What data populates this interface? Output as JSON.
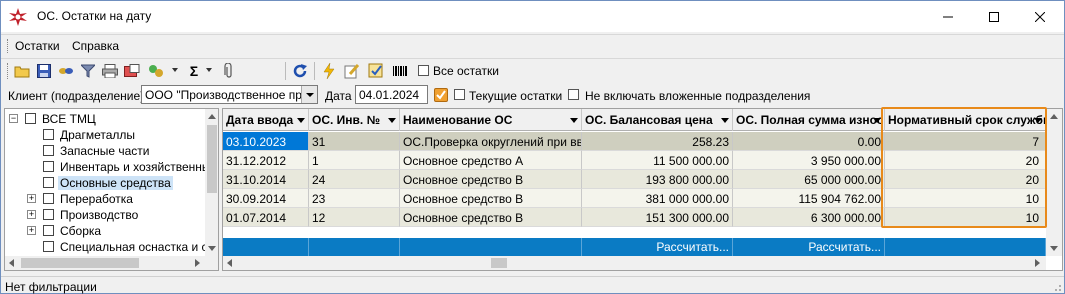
{
  "window": {
    "title": "ОС. Остатки на дату",
    "controls": {
      "minimize": "minimize-icon",
      "maximize": "maximize-icon",
      "close": "close-icon"
    }
  },
  "menu": {
    "items": [
      "Остатки",
      "Справка"
    ]
  },
  "toolbar": {
    "icons": [
      "open-folder-icon",
      "save-icon",
      "link-icon",
      "filter-icon",
      "print-icon",
      "export-icon",
      "chart-icon",
      "sum-icon",
      "attach-icon",
      "refresh-icon",
      "lightning-icon",
      "edit-icon",
      "check-edit-icon",
      "barcode-icon"
    ],
    "all_balances_label": "Все остатки"
  },
  "filter": {
    "client_label": "Клиент (подразделение)",
    "client_value": "ООО \"Производственное предп",
    "date_label": "Дата",
    "date_value": "04.01.2024",
    "current_balances_label": "Текущие остатки",
    "exclude_nested_label": "Не включать вложенные подразделения"
  },
  "tree": {
    "items": [
      {
        "label": "ВСЕ ТМЦ",
        "expander": "−"
      },
      {
        "label": "Драгметаллы"
      },
      {
        "label": "Запасные части"
      },
      {
        "label": "Инвентарь и хозяйственные"
      },
      {
        "label": "Основные средства",
        "selected": true
      },
      {
        "label": "Переработка",
        "expander": "+"
      },
      {
        "label": "Производство",
        "expander": "+"
      },
      {
        "label": "Сборка",
        "expander": "+"
      },
      {
        "label": "Специальная оснастка и спе"
      }
    ]
  },
  "grid": {
    "columns": [
      "Дата ввода",
      "ОС. Инв. №",
      "Наименование ОС",
      "ОС. Балансовая цена",
      "ОС. Полная сумма износ",
      "Нормативный срок службы"
    ],
    "rows": [
      [
        "03.10.2023",
        "31",
        "ОС.Проверка округлений при вводе",
        "258.23",
        "0.00",
        "7"
      ],
      [
        "31.12.2012",
        "1",
        "Основное средство А",
        "11 500 000.00",
        "3 950 000.00",
        "20"
      ],
      [
        "31.10.2014",
        "24",
        "Основное средство В",
        "193 800 000.00",
        "65 000 000.00",
        "20"
      ],
      [
        "30.09.2014",
        "23",
        "Основное средство В",
        "381 000 000.00",
        "115 904 762.00",
        "10"
      ],
      [
        "01.07.2014",
        "12",
        "Основное средство В",
        "151 300 000.00",
        "6 300 000.00",
        "10"
      ]
    ],
    "footer": [
      "",
      "",
      "",
      "Рассчитать...",
      "Рассчитать...",
      ""
    ]
  },
  "status": {
    "text": "Нет фильтрации"
  }
}
